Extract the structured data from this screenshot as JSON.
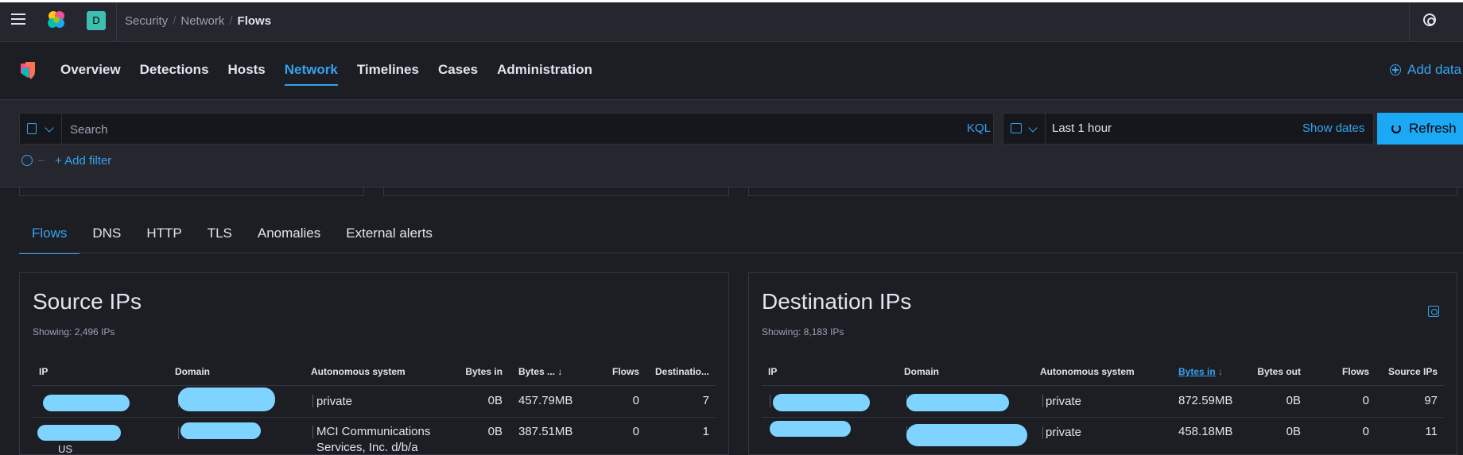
{
  "header": {
    "space_initial": "D",
    "breadcrumbs": [
      "Security",
      "Network",
      "Flows"
    ]
  },
  "nav": {
    "items": [
      "Overview",
      "Detections",
      "Hosts",
      "Network",
      "Timelines",
      "Cases",
      "Administration"
    ],
    "active": "Network",
    "add_data": "Add data"
  },
  "search": {
    "placeholder": "Search",
    "language": "KQL",
    "date_range": "Last 1 hour",
    "show_dates": "Show dates",
    "refresh": "Refresh",
    "add_filter": "+ Add filter"
  },
  "tabs": {
    "items": [
      "Flows",
      "DNS",
      "HTTP",
      "TLS",
      "Anomalies",
      "External alerts"
    ],
    "active": "Flows"
  },
  "source_panel": {
    "title": "Source IPs",
    "showing": "Showing: 2,496 IPs",
    "columns": [
      "IP",
      "Domain",
      "Autonomous system",
      "Bytes in",
      "Bytes ...",
      "Flows",
      "Destinatio..."
    ],
    "rows": [
      {
        "as": "private",
        "bytes_in": "0B",
        "bytes_out": "457.79MB",
        "flows": "0",
        "dest": "7"
      },
      {
        "as": "MCI Communications",
        "as2": "Services, Inc. d/b/a",
        "bytes_in": "0B",
        "bytes_out": "387.51MB",
        "flows": "0",
        "dest": "1",
        "country": "US"
      }
    ]
  },
  "dest_panel": {
    "title": "Destination IPs",
    "showing": "Showing: 8,183 IPs",
    "columns": [
      "IP",
      "Domain",
      "Autonomous system",
      "Bytes in",
      "Bytes out",
      "Flows",
      "Source IPs"
    ],
    "rows": [
      {
        "as": "private",
        "bytes_in": "872.59MB",
        "bytes_out": "0B",
        "flows": "0",
        "src": "97"
      },
      {
        "as": "private",
        "bytes_in": "458.18MB",
        "bytes_out": "0B",
        "flows": "0",
        "src": "11"
      }
    ]
  },
  "colors": {
    "accent": "#36a2ef",
    "background": "#1d1e24",
    "header": "#25262e",
    "refresh_button": "#1ba9f5",
    "redaction": "#7fd3ff"
  }
}
